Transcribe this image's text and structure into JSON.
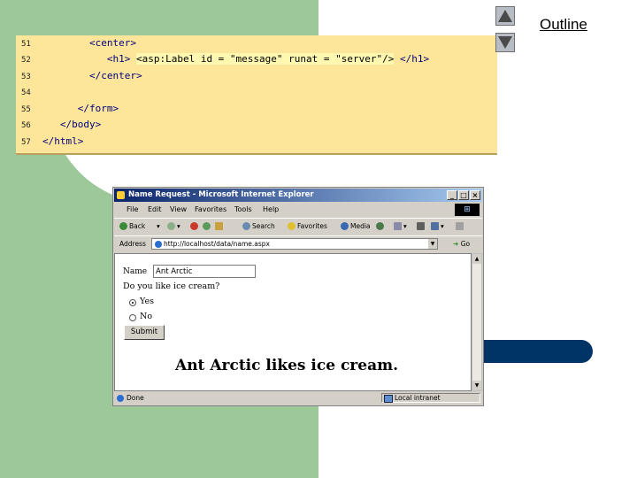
{
  "slide": {
    "outline_link": "Outline",
    "colors": {
      "green_band": "#9dc89a",
      "blue_bar": "#003366",
      "code_bg": "#fde699"
    }
  },
  "code": {
    "lines": [
      {
        "num": "51",
        "text": "        <center>"
      },
      {
        "num": "52",
        "text": "           <h1> ",
        "highlight": "<asp:Label id = \"message\" runat = \"server\"/>",
        "tail": " </h1>"
      },
      {
        "num": "53",
        "text": "        </center>"
      },
      {
        "num": "54",
        "text": ""
      },
      {
        "num": "55",
        "text": "      </form>"
      },
      {
        "num": "56",
        "text": "   </body>"
      },
      {
        "num": "57",
        "text": "</html>"
      }
    ]
  },
  "browser": {
    "title": "Name Request - Microsoft Internet Explorer",
    "menu": [
      "File",
      "Edit",
      "View",
      "Favorites",
      "Tools",
      "Help"
    ],
    "toolbar": {
      "back": "Back",
      "search": "Search",
      "favorites": "Favorites",
      "media": "Media"
    },
    "address_label": "Address",
    "address_url": "http://localhost/data/name.aspx",
    "go": "Go",
    "page": {
      "name_label": "Name",
      "name_value": "Ant Arctic",
      "question": "Do you like ice cream?",
      "options": [
        {
          "label": "Yes",
          "selected": true
        },
        {
          "label": "No",
          "selected": false
        }
      ],
      "submit": "Submit",
      "result": "Ant Arctic likes ice cream."
    },
    "status": "Done",
    "zone": "Local intranet"
  }
}
